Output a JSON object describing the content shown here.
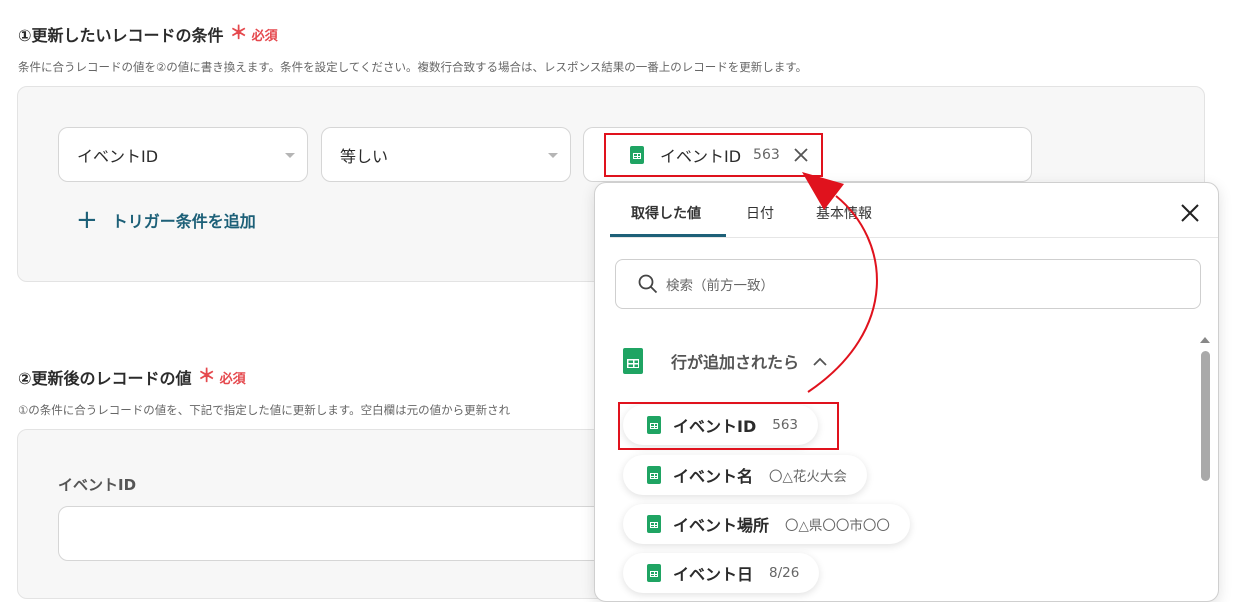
{
  "section1": {
    "title": "①更新したいレコードの条件",
    "required": "必須",
    "hint": "条件に合うレコードの値を②の値に書き換えます。条件を設定してください。複数行合致する場合は、レスポンス結果の一番上のレコードを更新します。",
    "field_select": "イベントID",
    "operator_select": "等しい",
    "value_chip": {
      "label": "イベントID",
      "value": "563"
    },
    "add_condition": "トリガー条件を追加"
  },
  "section2": {
    "title": "②更新後のレコードの値",
    "required": "必須",
    "hint": "①の条件に合うレコードの値を、下記で指定した値に更新します。空白欄は元の値から更新され",
    "field_label": "イベントID",
    "field_value": ""
  },
  "dropdown": {
    "tabs": [
      "取得した値",
      "日付",
      "基本情報"
    ],
    "active_tab": 0,
    "search_placeholder": "検索（前方一致）",
    "group_label": "行が追加されたら",
    "items": [
      {
        "label": "イベントID",
        "value": "563"
      },
      {
        "label": "イベント名",
        "value": "〇△花火大会"
      },
      {
        "label": "イベント場所",
        "value": "〇△県〇〇市〇〇"
      },
      {
        "label": "イベント日",
        "value": "8/26"
      }
    ]
  },
  "icons": {
    "sheet": "spreadsheet-icon",
    "close": "close-icon",
    "search": "search-icon",
    "chevron": "chevron-up-icon",
    "plus": "plus-icon"
  },
  "colors": {
    "accent": "#1d6078",
    "required": "#e5484d",
    "highlight": "#e0121d",
    "sheet": "#1fa463"
  }
}
